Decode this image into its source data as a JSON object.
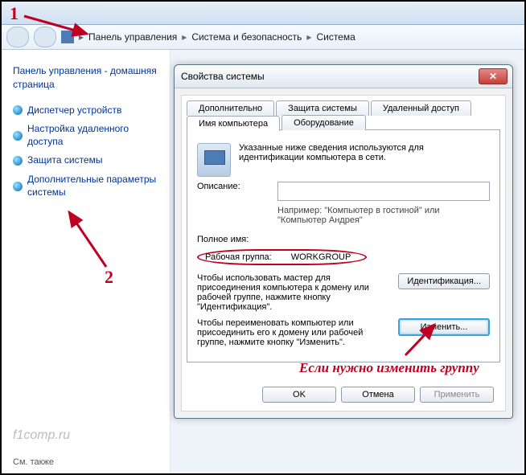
{
  "breadcrumb": {
    "items": [
      "Панель управления",
      "Система и безопасность",
      "Система"
    ]
  },
  "sidebar": {
    "heading": "Панель управления - домашняя страница",
    "links": [
      "Диспетчер устройств",
      "Настройка удаленного доступа",
      "Защита системы",
      "Дополнительные параметры системы"
    ],
    "footer": "См. также",
    "logo": "f1comp.ru"
  },
  "dialog": {
    "title": "Свойства системы",
    "tabs_row1": [
      "Дополнительно",
      "Защита системы",
      "Удаленный доступ"
    ],
    "tabs_row2": [
      "Имя компьютера",
      "Оборудование"
    ],
    "intro": "Указанные ниже сведения используются для идентификации компьютера в сети.",
    "desc_label": "Описание:",
    "desc_hint": "Например: \"Компьютер в гостиной\" или \"Компьютер Андрея\"",
    "fullname_label": "Полное имя:",
    "workgroup_label": "Рабочая группа:",
    "workgroup_value": "WORKGROUP",
    "ident_text": "Чтобы использовать мастер для присоединения компьютера к домену или рабочей группе, нажмите кнопку \"Идентификация\".",
    "ident_btn": "Идентификация...",
    "change_text": "Чтобы переименовать компьютер или присоединить его к домену или рабочей группе, нажмите кнопку \"Изменить\".",
    "change_btn": "Изменить...",
    "ok": "OK",
    "cancel": "Отмена",
    "apply": "Применить"
  },
  "annotations": {
    "one": "1",
    "two": "2",
    "note": "Если нужно изменить группу"
  }
}
